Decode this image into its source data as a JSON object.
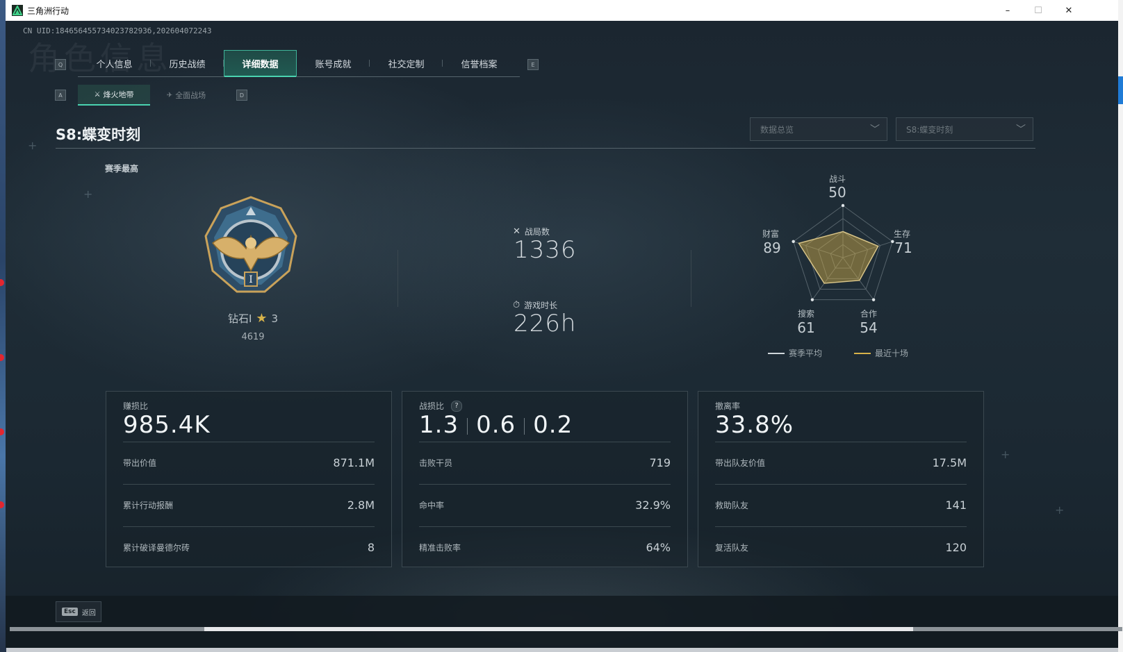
{
  "window": {
    "title": "三角洲行动",
    "min": "–",
    "max": "☐",
    "close": "✕"
  },
  "uid": "CN UID:18465645573402378293б,202604072243",
  "bg_title": "角色信息",
  "keys": {
    "tab_prev": "Q",
    "tab_next": "E",
    "sub_prev": "A",
    "sub_next": "D"
  },
  "tabs": [
    {
      "label": "个人信息"
    },
    {
      "label": "历史战绩"
    },
    {
      "label": "详细数据"
    },
    {
      "label": "账号成就"
    },
    {
      "label": "社交定制"
    },
    {
      "label": "信誉档案"
    }
  ],
  "subtabs": [
    {
      "label": "烽火地带",
      "icon": "⚔"
    },
    {
      "label": "全面战场",
      "icon": "✈"
    }
  ],
  "season": {
    "title": "S8:蝶变时刻"
  },
  "dropdowns": {
    "overview": "数据总览",
    "season": "S8:蝶变时刻"
  },
  "rank": {
    "section_label": "赛季最高",
    "name": "钻石I",
    "stars": "3",
    "score": "4619"
  },
  "stats": {
    "matches_label": "战局数",
    "matches_value": "1336",
    "playtime_label": "游戏时长",
    "playtime_value": "226h"
  },
  "radar": {
    "labels": {
      "combat": "战斗",
      "survival": "生存",
      "cooperation": "合作",
      "search": "搜索",
      "wealth": "财富"
    },
    "values": {
      "combat": 50,
      "survival": 71,
      "cooperation": 54,
      "search": 61,
      "wealth": 89
    },
    "legend": {
      "season_avg": "赛季平均",
      "recent_ten": "最近十场"
    },
    "colors": {
      "season_avg": "#cfd6da",
      "recent_ten": "#d8b24a"
    }
  },
  "cards": {
    "profit": {
      "title": "赚损比",
      "value": "985.4K",
      "rows": [
        {
          "k": "带出价值",
          "v": "871.1M"
        },
        {
          "k": "累计行动报酬",
          "v": "2.8M"
        },
        {
          "k": "累计破译曼德尔砖",
          "v": "8"
        }
      ]
    },
    "kd": {
      "title": "战损比",
      "help": "?",
      "v1": "1.3",
      "v2": "0.6",
      "v3": "0.2",
      "rows": [
        {
          "k": "击败干员",
          "v": "719"
        },
        {
          "k": "命中率",
          "v": "32.9%"
        },
        {
          "k": "精准击败率",
          "v": "64%"
        }
      ]
    },
    "extract": {
      "title": "撤离率",
      "value": "33.8%",
      "rows": [
        {
          "k": "带出队友价值",
          "v": "17.5M"
        },
        {
          "k": "救助队友",
          "v": "141"
        },
        {
          "k": "复活队友",
          "v": "120"
        }
      ]
    }
  },
  "footer": {
    "esc_key": "Esc",
    "back_label": "返回"
  }
}
